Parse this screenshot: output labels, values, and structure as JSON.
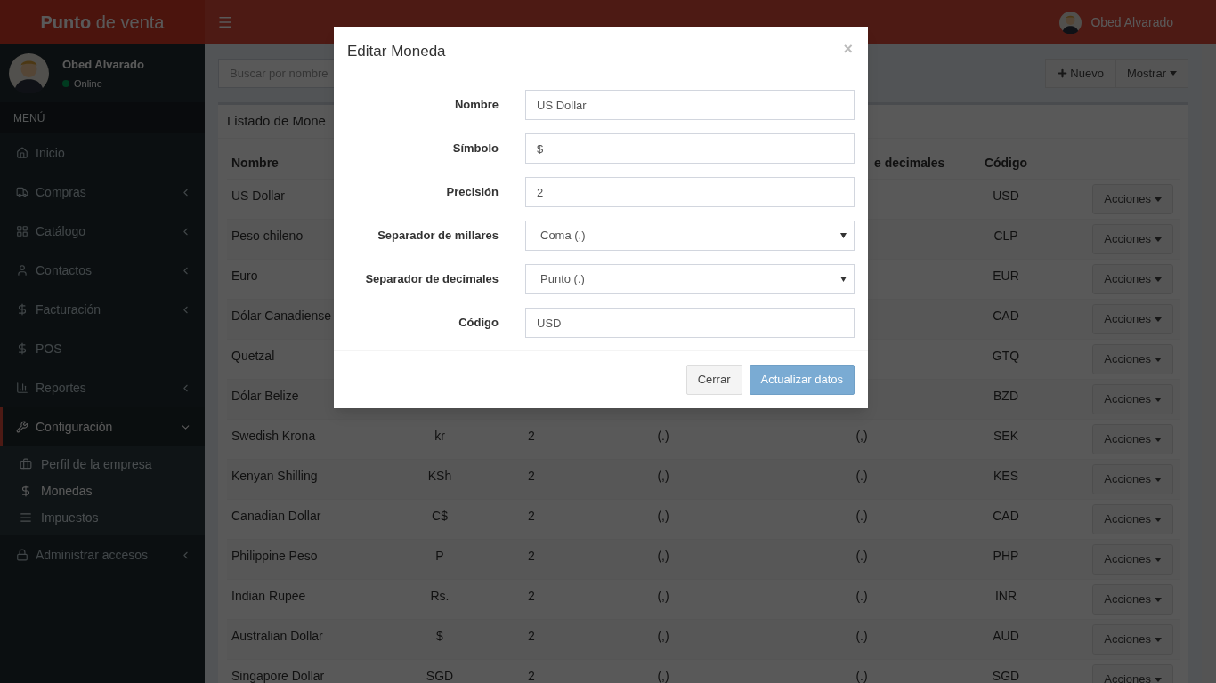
{
  "header": {
    "brand_bold": "Punto",
    "brand_rest": "de venta",
    "user_name": "Obed Alvarado"
  },
  "sidebar": {
    "user": {
      "name": "Obed Alvarado",
      "status": "Online"
    },
    "section_label": "MENÚ",
    "items": [
      {
        "label": "Inicio",
        "selected": false
      },
      {
        "label": "Compras",
        "selected": false,
        "expanded": false
      },
      {
        "label": "Catálogo",
        "selected": false,
        "expanded": false
      },
      {
        "label": "Contactos",
        "selected": false,
        "expanded": false
      },
      {
        "label": "Facturación",
        "selected": false,
        "expanded": false
      },
      {
        "label": "POS",
        "selected": false
      },
      {
        "label": "Reportes",
        "selected": false,
        "expanded": false
      },
      {
        "label": "Configuración",
        "selected": true,
        "expanded": true,
        "children": [
          {
            "label": "Perfil de la empresa",
            "selected": false
          },
          {
            "label": "Monedas",
            "selected": true
          },
          {
            "label": "Impuestos",
            "selected": false
          }
        ]
      },
      {
        "label": "Administrar accesos",
        "selected": false,
        "expanded": false
      }
    ]
  },
  "toolbar": {
    "search": {
      "placeholder": "Buscar por nombre"
    },
    "buttons": [
      "Nuevo",
      "Mostrar"
    ]
  },
  "list": {
    "title": "Listado de Mone",
    "columns": [
      {
        "label": "Nombre"
      },
      {},
      {},
      {},
      {
        "label": "e decimales"
      },
      {
        "label": "Código"
      }
    ],
    "rows": [
      {
        "name": "US Dollar",
        "code": "USD",
        "action": "Acciones"
      },
      {
        "name": "Peso chileno",
        "code": "CLP",
        "action": "Acciones"
      },
      {
        "name": "Euro",
        "code": "EUR",
        "action": "Acciones"
      },
      {
        "name": "Dólar Canadiense",
        "code": "CAD",
        "action": "Acciones"
      },
      {
        "name": "Quetzal",
        "code": "GTQ",
        "action": "Acciones"
      },
      {
        "name": "Dólar Belize",
        "code": "BZD",
        "action": "Acciones"
      },
      {
        "name": "Swedish Krona",
        "symbol": "kr",
        "precision": "2",
        "thousands": "(.)",
        "decimals": "(,)",
        "code": "SEK",
        "action": "Acciones"
      },
      {
        "name": "Kenyan Shilling",
        "symbol": "KSh",
        "precision": "2",
        "thousands": "(,)",
        "decimals": "(.)",
        "code": "KES",
        "action": "Acciones"
      },
      {
        "name": "Canadian Dollar",
        "symbol": "C$",
        "precision": "2",
        "thousands": "(,)",
        "decimals": "(.)",
        "code": "CAD",
        "action": "Acciones"
      },
      {
        "name": "Philippine Peso",
        "symbol": "P",
        "precision": "2",
        "thousands": "(,)",
        "decimals": "(.)",
        "code": "PHP",
        "action": "Acciones"
      },
      {
        "name": "Indian Rupee",
        "symbol": "Rs.",
        "precision": "2",
        "thousands": "(,)",
        "decimals": "(.)",
        "code": "INR",
        "action": "Acciones"
      },
      {
        "name": "Australian Dollar",
        "symbol": "$",
        "precision": "2",
        "thousands": "(,)",
        "decimals": "(.)",
        "code": "AUD",
        "action": "Acciones"
      },
      {
        "name": "Singapore Dollar",
        "symbol": "SGD",
        "precision": "2",
        "thousands": "(,)",
        "decimals": "(.)",
        "code": "SGD",
        "action": "Acciones"
      }
    ]
  },
  "modal": {
    "title": "Editar Moneda",
    "close": "×",
    "fields": [
      {
        "label": "Nombre",
        "kind": "text",
        "value": "US Dollar"
      },
      {
        "label": "Símbolo",
        "kind": "text",
        "value": "$"
      },
      {
        "label": "Precisión",
        "kind": "text",
        "value": "2"
      },
      {
        "label": "Separador de millares",
        "kind": "select",
        "value": "Coma (,)"
      },
      {
        "label": "Separador de decimales",
        "kind": "select",
        "value": "Punto (.)"
      },
      {
        "label": "Código",
        "kind": "text",
        "value": "USD"
      }
    ],
    "buttons": [
      {
        "label": "Cerrar",
        "kind": "default"
      },
      {
        "label": "Actualizar datos",
        "kind": "primary"
      }
    ]
  }
}
